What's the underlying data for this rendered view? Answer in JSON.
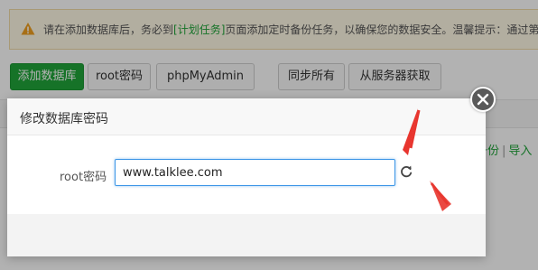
{
  "notice": {
    "text_before": "请在添加数据库后，务必到",
    "link": "[计划任务]",
    "text_after": "页面添加定时备份任务，以确保您的数据安全。温馨提示：通过第"
  },
  "toolbar": {
    "add_db": "添加数据库",
    "root_pw": "root密码",
    "phpmyadmin": "phpMyAdmin",
    "sync_all": "同步所有",
    "fetch_server": "从服务器获取"
  },
  "table": {
    "row_links": [
      "备份",
      "导入"
    ]
  },
  "modal": {
    "title": "修改数据库密码",
    "label": "root密码",
    "value": "www.talklee.com"
  },
  "colors": {
    "primary": "#20a53a",
    "focus_border": "#3b95e6",
    "annotation": "#e8352e"
  },
  "icons": {
    "notice": "warning-icon",
    "close": "close-icon",
    "refresh": "refresh-icon"
  }
}
